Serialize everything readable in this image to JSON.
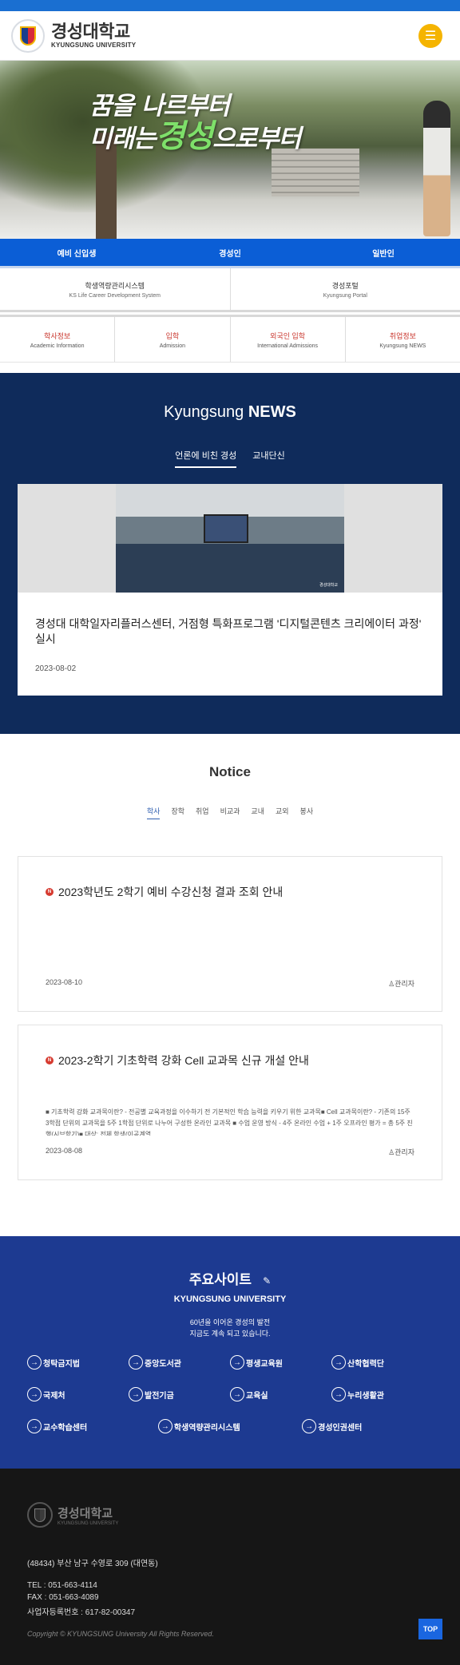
{
  "header": {
    "logo_ko": "경성대학교",
    "logo_en": "KYUNGSUNG UNIVERSITY",
    "menu_icon": "hamburger-icon"
  },
  "hero": {
    "slogan_line1": "꿈을 나르부터",
    "slogan_line2_pre": "미래는",
    "slogan_highlight": "경성",
    "slogan_line2_post": "으로부터"
  },
  "audience": [
    "예비 신입생",
    "경성인",
    "일반인"
  ],
  "portals": [
    {
      "title": "학생역량관리시스템",
      "sub": "KS Life Career Development System"
    },
    {
      "title": "경성포털",
      "sub": "Kyungsung Portal"
    }
  ],
  "quick_links": [
    {
      "title": "학사정보",
      "sub": "Academic Information"
    },
    {
      "title": "입학",
      "sub": "Admission"
    },
    {
      "title": "외국인 입학",
      "sub": "International Admissions"
    },
    {
      "title": "취업정보",
      "sub": "Kyungsung NEWS"
    }
  ],
  "news": {
    "heading_light": "Kyungsung",
    "heading_bold": "NEWS",
    "tabs": [
      "언론에 비친 경성",
      "교내단신"
    ],
    "active_tab": 0,
    "card": {
      "title": "경성대 대학일자리플러스센터, 거점형 특화프로그램 '디지털콘텐츠 크리에이터 과정' 실시",
      "date": "2023-08-02",
      "photo_mark": "경성대학교"
    }
  },
  "notice": {
    "heading": "Notice",
    "tabs": [
      "학사",
      "장학",
      "취업",
      "비교과",
      "교내",
      "교외",
      "봉사"
    ],
    "active_tab": 0,
    "items": [
      {
        "badge": "N",
        "title": "2023학년도 2학기 예비 수강신청 결과 조회 안내",
        "summary": "",
        "date": "2023-08-10",
        "author": "관리자"
      },
      {
        "badge": "N",
        "title": "2023-2학기 기초학력 강화 Cell 교과목 신규 개설 안내",
        "summary": "■ 기초학력 강화 교과목이란? - 전공별 교육과정을 이수하기 전 기본적인 학습 능력을 키우기 위한 교과목■ Cell 교과목이란? - 기존의 15주 3학점 단위의 교과목을 5주 1학점 단위로 나누어 구성한 온라인 교과목 ■ 수업 운영 방식 - 4주 온라인 수업 + 1주 오프라인 평가 = 총 5주 진행(시브학기)■ 대상: 전체 학생(이공계열",
        "date": "2023-08-08",
        "author": "관리자"
      }
    ]
  },
  "sites": {
    "heading": "주요사이트",
    "subheading": "KYUNGSUNG UNIVERSITY",
    "desc_line1": "60년을 이어온 경성의 발전",
    "desc_line2": "지금도 계속 되고 있습니다.",
    "links_row1": [
      "청탁금지법",
      "중앙도서관",
      "평생교육원",
      "산학협력단"
    ],
    "links_row2": [
      "국제처",
      "발전기금",
      "교육실",
      "누리생활관"
    ],
    "links_row3": [
      "교수학습센터",
      "학생역량관리시스템",
      "경성인권센터"
    ]
  },
  "footer": {
    "logo_ko": "경성대학교",
    "logo_en": "KYUNGSUNG UNIVERSITY",
    "address": "(48434) 부산 남구 수영로 309 (대연동)",
    "tel": "TEL : 051-663-4114",
    "fax": "FAX : 051-663-4089",
    "biz": "사업자등록번호 : 617-82-00347",
    "copyright": "Copyright © KYUNGSUNG University All Rights Reserved.",
    "top_label": "TOP"
  },
  "colors": {
    "primary_blue": "#0b5ed6",
    "news_bg": "#0f2b5b",
    "sites_bg": "#1d3a91",
    "footer_bg": "#161616",
    "menu_yellow": "#f5b400",
    "badge_red": "#d63a2f"
  }
}
